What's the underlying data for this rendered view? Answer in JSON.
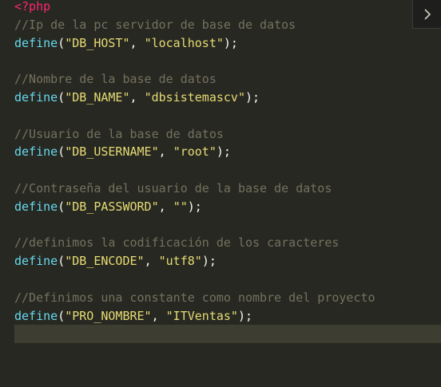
{
  "code": {
    "php_open": "<?php",
    "lines": [
      {
        "comment": "//Ip de la pc servidor de base de datos",
        "fn": "define",
        "const": "\"DB_HOST\"",
        "value": "\"localhost\""
      },
      {
        "comment": "//Nombre de la base de datos",
        "fn": "define",
        "const": "\"DB_NAME\"",
        "value": "\"dbsistemascv\""
      },
      {
        "comment": "//Usuario de la base de datos",
        "fn": "define",
        "const": "\"DB_USERNAME\"",
        "value": "\"root\""
      },
      {
        "comment": "//Contraseña del usuario de la base de datos",
        "fn": "define",
        "const": "\"DB_PASSWORD\"",
        "value": "\"\""
      },
      {
        "comment": "//definimos la codificación de los caracteres",
        "fn": "define",
        "const": "\"DB_ENCODE\"",
        "value": "\"utf8\""
      },
      {
        "comment": "//Definimos una constante como nombre del proyecto",
        "fn": "define",
        "const": "\"PRO_NOMBRE\"",
        "value": "\"ITVentas\""
      }
    ]
  },
  "toolbar": {
    "toggle_icon": "chevron-right-icon"
  },
  "colors": {
    "background": "#272822",
    "php_tag": "#f92672",
    "comment": "#75715e",
    "function": "#66d9ef",
    "string": "#e6db74",
    "current_line": "#3e3d32"
  }
}
